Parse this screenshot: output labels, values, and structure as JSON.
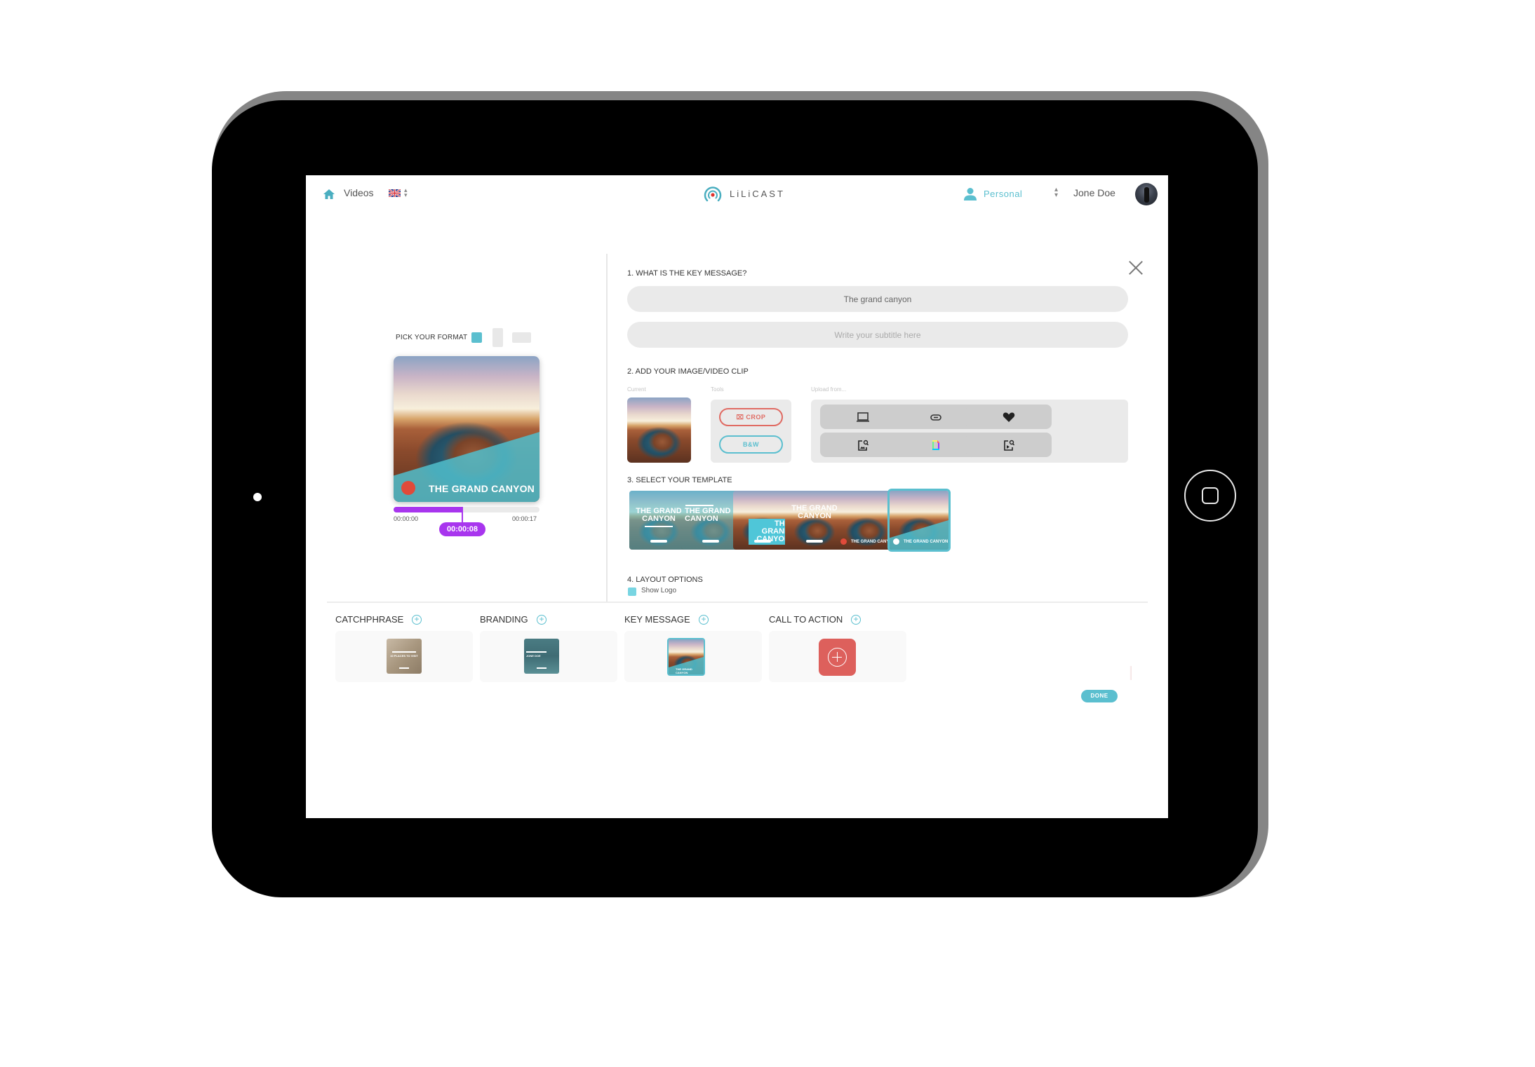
{
  "header": {
    "nav_label": "Videos",
    "language": "English (UK)",
    "brand": "LiLiCAST",
    "account_type": "Personal",
    "user_name": "Jone Doe"
  },
  "preview": {
    "pick_format_label": "PICK YOUR FORMAT",
    "formats": [
      "square",
      "portrait",
      "landscape"
    ],
    "selected_format": "square",
    "title": "THE GRAND CANYON",
    "time_start": "00:00:00",
    "time_end": "00:00:17",
    "time_current": "00:00:08",
    "progress": 0.47
  },
  "form": {
    "step1_title": "1. WHAT IS THE KEY MESSAGE?",
    "key_message_value": "The grand canyon",
    "subtitle_placeholder": "Write your subtitle here",
    "step2_title": "2. ADD YOUR IMAGE/VIDEO CLIP",
    "current_label": "Current",
    "tools_label": "Tools",
    "upload_label": "Upload from...",
    "crop_label": "CROP",
    "bw_label": "B&W",
    "upload_sources": [
      "computer",
      "link",
      "favorites",
      "image-search",
      "giphy",
      "video-search"
    ],
    "step3_title": "3. SELECT YOUR TEMPLATE",
    "template_text_line1": "THE GRAND",
    "template_text_line2": "CANYON",
    "template_text_full": "THE GRAND CANYON",
    "selected_template": 6,
    "step4_title": "4. LAYOUT OPTIONS",
    "show_logo_label": "Show Logo",
    "show_logo_checked": true
  },
  "sections": [
    {
      "title": "CATCHPHRASE",
      "scene_text": "10 PLACES TO VISIT"
    },
    {
      "title": "BRANDING",
      "scene_text": "JONE DOE"
    },
    {
      "title": "KEY MESSAGE",
      "scene_text": "THE GRAND CANYON"
    },
    {
      "title": "CALL TO ACTION",
      "scene_text": ""
    }
  ],
  "done_label": "DONE",
  "colors": {
    "accent": "#5bbfcf",
    "timeline": "#a835ee",
    "danger": "#dd605c"
  }
}
